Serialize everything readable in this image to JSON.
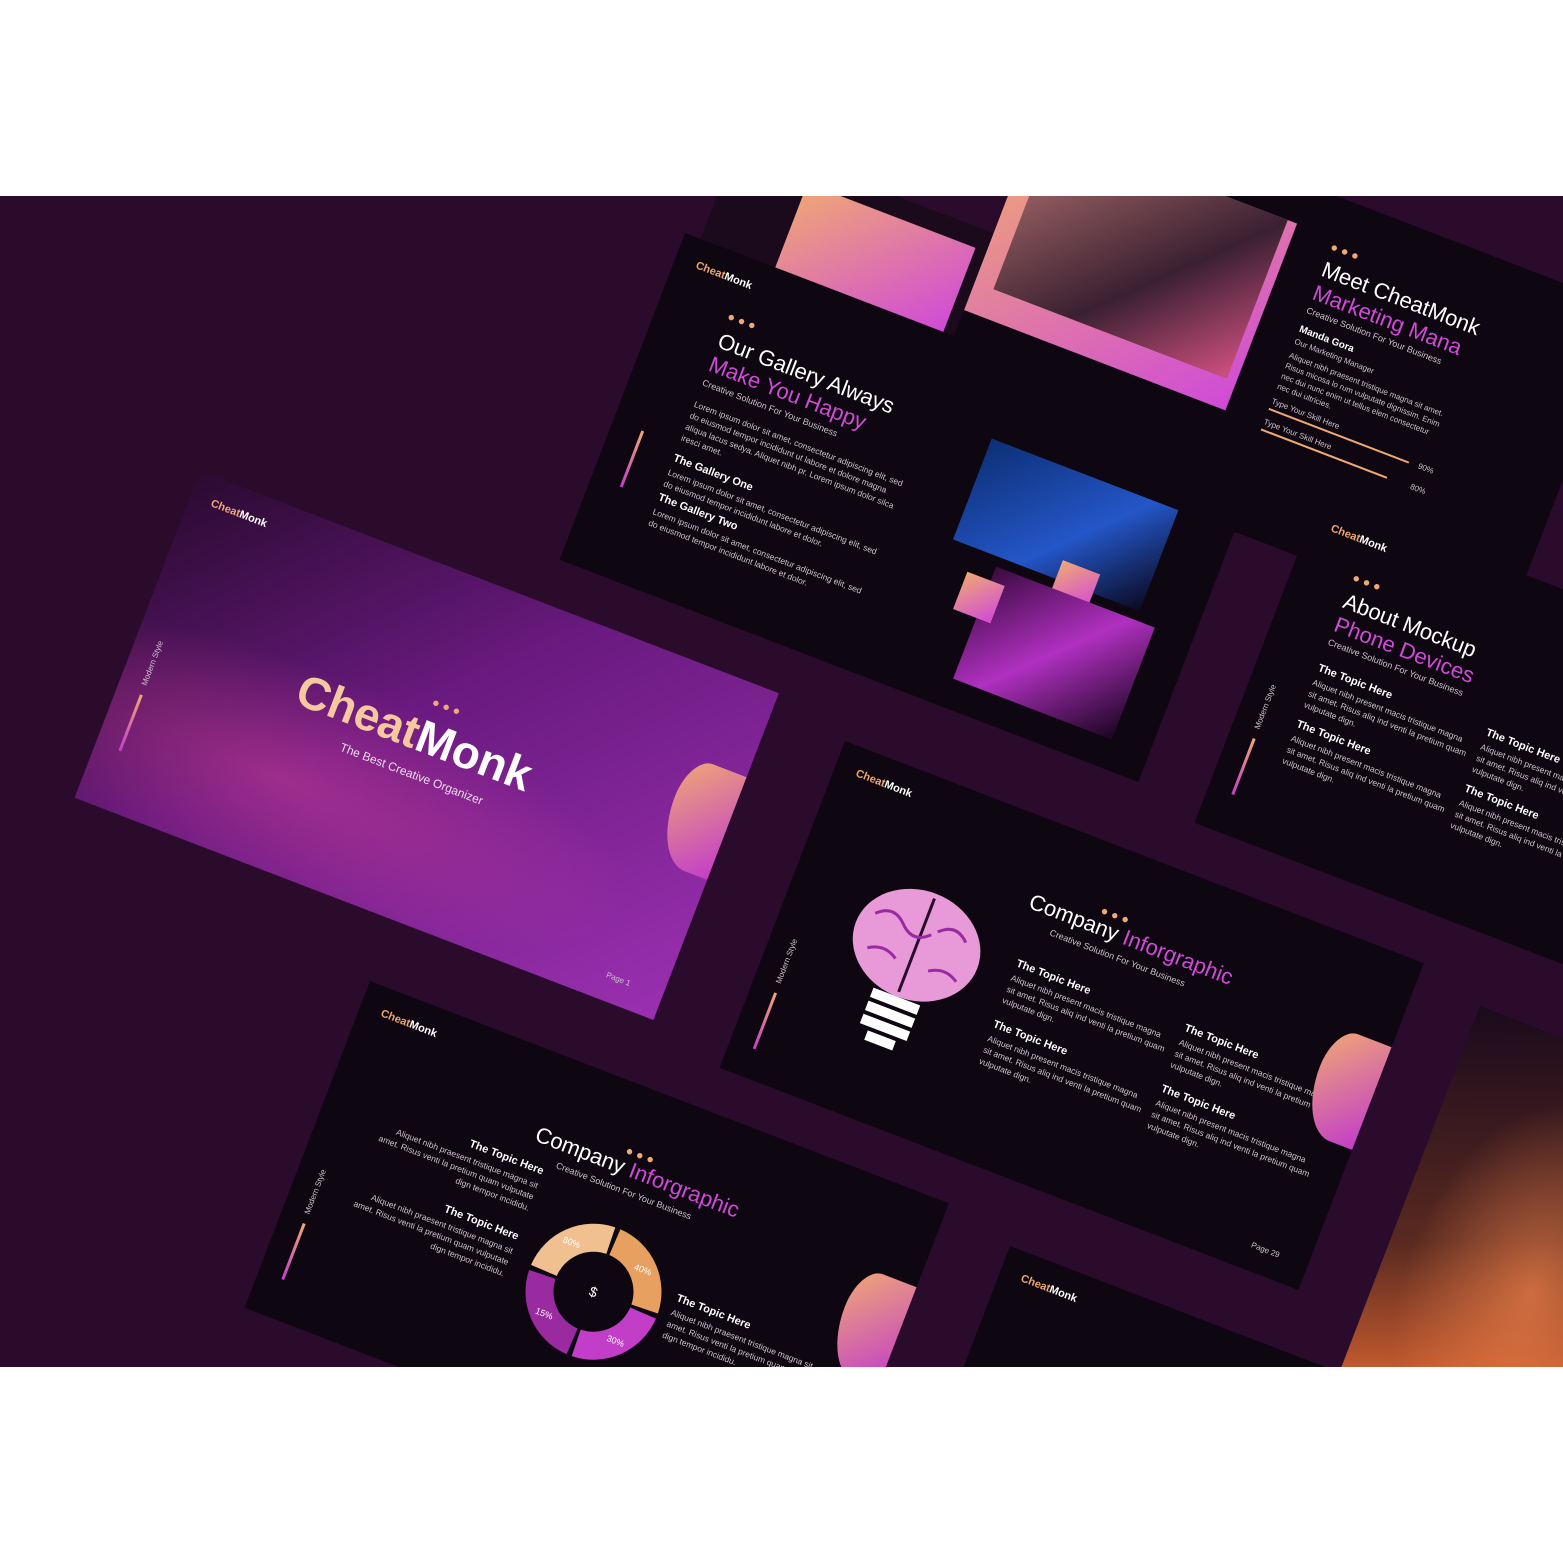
{
  "brand": {
    "part1": "Cheat",
    "part2": "Monk"
  },
  "side_label": "Modern Style",
  "hero": {
    "title_part1": "Cheat",
    "title_part2": "Monk",
    "subtitle": "The Best Creative Organizer",
    "page": "Page 1"
  },
  "gallery": {
    "title_line1": "Our Gallery Always",
    "title_line2": "Make You Happy",
    "subtitle": "Creative Solution For Your Business",
    "intro": "Lorem ipsum dolor sit amet, consectetur adipiscing elit, sed do eiusmod tempor incididunt ut labore et dolore magna aliqua lacus sedya. Aliquet nibh pr. Lorem ipsum dolor silca iresci amet.",
    "items": [
      {
        "title": "The Gallery One",
        "text": "Lorem ipsum dolor sit amet, consectetur adipiscing elit, sed do eiusmod tempor incididunt labore et dolor."
      },
      {
        "title": "The Gallery Two",
        "text": "Lorem ipsum dolor sit amet, consectetur adipiscing elit, sed do eiusmod tempor incididunt labore et dolor."
      }
    ]
  },
  "team": {
    "title_line1": "Meet CheatMonk",
    "title_line2": "Marketing Mana",
    "subtitle": "Creative Solution For Your Business",
    "name": "Manda Gora",
    "role": "Our Marketing Manager",
    "bio": "Aliquet nibh praesent tristique magna sit amet. Risus micosa lo rum vulputate dignissim. Enim nec dui nunc enim ut tellus elem consectetur nec dui ultricies.",
    "skills": [
      {
        "label": "Type Your Skill Here",
        "value": "90%"
      },
      {
        "label": "Type Your Skill Here",
        "value": "80%"
      }
    ]
  },
  "about": {
    "title_line1": "About Mockup",
    "title_line2": "Phone Devices",
    "subtitle": "Creative Solution For Your Business",
    "topics": [
      {
        "title": "The Topic Here",
        "text": "Aliquet nibh present macis tristique magna sit amet. Risus aliq ind venti la pretium quam vulputate dign."
      },
      {
        "title": "The Topic Here",
        "text": "Aliquet nibh present macis tristique magna sit amet. Risus aliq ind venti la pretium quam vulputate dign."
      },
      {
        "title": "The Topic Here",
        "text": "Aliquet nibh present macis tristique magna sit amet. Risus aliq ind venti la pretium quam vulputate dign."
      },
      {
        "title": "The Topic Here",
        "text": "Aliquet nibh present macis tristique magna sit amet. Risus aliq ind venti la pretium quam vulputate dign."
      }
    ]
  },
  "infographic": {
    "title_line1": "Company",
    "title_line2": "Inforgraphic",
    "subtitle": "Creative Solution For Your Business",
    "page": "Page 29",
    "topics": [
      {
        "title": "The Topic Here",
        "text": "Aliquet nibh present macis tristique magna sit amet. Risus aliq ind venti la pretium quam vulputate dign."
      },
      {
        "title": "The Topic Here",
        "text": "Aliquet nibh present macis tristique magna sit amet. Risus aliq ind venti la pretium quam vulputate dign."
      },
      {
        "title": "The Topic Here",
        "text": "Aliquet nibh present macis tristique magna sit amet. Risus aliq ind venti la pretium quam vulputate dign."
      },
      {
        "title": "The Topic Here",
        "text": "Aliquet nibh present macis tristique magna sit amet. Risus aliq ind venti la pretium quam vulputate dign."
      }
    ]
  },
  "donut_slide": {
    "title_line1": "Company",
    "title_line2": "Inforgraphic",
    "subtitle": "Creative Solution For Your Business",
    "topics": [
      {
        "title": "The Topic Here",
        "text": "Aliquet nibh praesent tristique magna sit amet. Risus venti la pretium quam vulputate dign tempor incididu."
      },
      {
        "title": "The Topic Here",
        "text": "Aliquet nibh praesent tristique magna sit amet. Risus venti la pretium quam vulputate dign tempor incididu."
      },
      {
        "title": "The Topic Here",
        "text": "Aliquet nibh praesent tristique magna sit amet. Risus venti la pretium quam vulputate dign tempor incididu."
      }
    ],
    "segments": [
      {
        "label": "80%",
        "color": "#f0c090"
      },
      {
        "label": "40%",
        "color": "#e8a060"
      },
      {
        "label": "30%",
        "color": "#c23ec9"
      },
      {
        "label": "15%",
        "color": "#9a2aa0"
      }
    ]
  },
  "colors": {
    "accent_orange": "#f0a874",
    "accent_purple": "#d04ad8",
    "background": "#2a0b2c"
  }
}
